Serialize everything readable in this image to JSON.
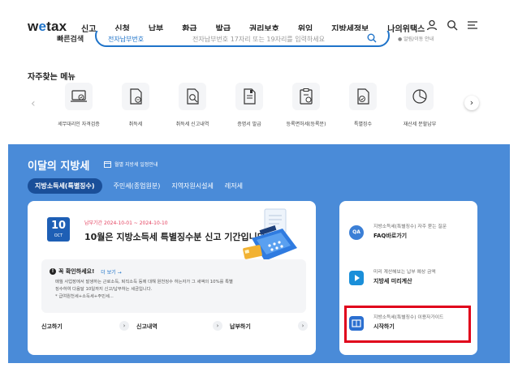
{
  "header": {
    "logo_prefix": "w",
    "logo_o": "e",
    "logo_suffix": "tax",
    "nav": [
      "신고",
      "신청",
      "납부",
      "환급",
      "발급",
      "권리보호",
      "위임",
      "지방세정보",
      "나의위택스"
    ],
    "icons": [
      "user-icon",
      "search-icon",
      "menu-icon"
    ]
  },
  "search": {
    "label": "빠른검색",
    "select": "전자납부번호",
    "placeholder": "전자납부번호 17자리 또는 19자리를 입력하세요",
    "note": "● 알림/이동 안내"
  },
  "faq": {
    "title": "자주찾는 메뉴",
    "items": [
      {
        "label": "세무대리인 자격검증",
        "icon": "laptop-check-icon"
      },
      {
        "label": "취득세",
        "icon": "document-icon"
      },
      {
        "label": "취득세 신고내역",
        "icon": "document-search-icon"
      },
      {
        "label": "증명서 발급",
        "icon": "certificate-icon"
      },
      {
        "label": "등록면허세(등록분)",
        "icon": "clipboard-icon"
      },
      {
        "label": "특별징수",
        "icon": "document-check-icon"
      },
      {
        "label": "재산세 분할납부",
        "icon": "pie-chart-icon"
      }
    ]
  },
  "monthly": {
    "title": "이달의 지방세",
    "sub": "월별 지방세 일정안내",
    "tabs": [
      "지방소득세(특별징수)",
      "주민세(종업원분)",
      "지역자원시설세",
      "레저세"
    ],
    "day": "10",
    "month": "OCT",
    "period_label": "납부기간",
    "period": "2024-10-01 ~ 2024-10-10",
    "headline": "10월은 지방소득세 특별징수분 신고 기간입니다.",
    "notice_title": "꼭 확인하세요!",
    "notice_more": "더 보기 →",
    "notice_body": [
      "매월 사업장에서 발생하는 근로소득, 퇴직소득 등에 대해 원천징수 하는자가 그 세액의 10%를 특별",
      "징수하여 다음달 10일까지 신고/납부하는 세금입니다.",
      "* 급여원천세+소득세+주민세..."
    ],
    "links": [
      "신고하기",
      "신고내역",
      "납부하기"
    ],
    "right": [
      {
        "small": "지방소득세(특별징수) 자주 묻는 질문",
        "big": "FAQ바로가기",
        "color": "#3b7fd6"
      },
      {
        "small": "미리 계산해보는 납부 예상 금액",
        "big": "지방세 미리계산",
        "color": "#1a8fd9"
      },
      {
        "small": "지방소득세(특별징수) 이용자가이드",
        "big": "시작하기",
        "color": "#2b6fd0"
      }
    ]
  }
}
